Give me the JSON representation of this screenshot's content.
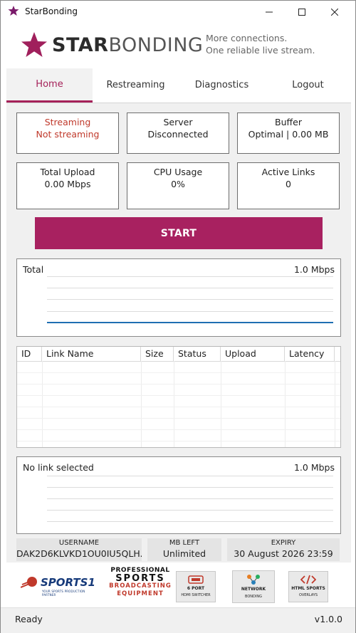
{
  "window": {
    "title": "StarBonding"
  },
  "header": {
    "brand_bold": "STAR",
    "brand_light": "BONDING",
    "tagline_1": "More connections.",
    "tagline_2": "One reliable live stream."
  },
  "tabs": [
    {
      "label": "Home",
      "active": true
    },
    {
      "label": "Restreaming",
      "active": false
    },
    {
      "label": "Diagnostics",
      "active": false
    },
    {
      "label": "Logout",
      "active": false
    }
  ],
  "stats": {
    "streaming": {
      "label": "Streaming",
      "value": "Not streaming"
    },
    "server": {
      "label": "Server",
      "value": "Disconnected"
    },
    "buffer": {
      "label": "Buffer",
      "value": "Optimal | 0.00 MB"
    },
    "upload": {
      "label": "Total Upload",
      "value": "0.00 Mbps"
    },
    "cpu": {
      "label": "CPU Usage",
      "value": "0%"
    },
    "links": {
      "label": "Active Links",
      "value": "0"
    }
  },
  "start_button": {
    "label": "START"
  },
  "total_graph": {
    "label": "Total",
    "max_label": "1.0 Mbps"
  },
  "links_table": {
    "columns": [
      "ID",
      "Link Name",
      "Size",
      "Status",
      "Upload",
      "Latency"
    ],
    "rows": []
  },
  "link_graph": {
    "label": "No link selected",
    "max_label": "1.0 Mbps"
  },
  "account": {
    "username_label": "USERNAME",
    "username": "DAK2D6KLVKD1OU0IU5QLH...",
    "mb_left_label": "MB LEFT",
    "mb_left": "Unlimited",
    "expiry_label": "EXPIRY",
    "expiry": "30 August 2026 23:59"
  },
  "partners": {
    "sports1": "SPORTS1",
    "sports1_sub": "YOUR SPORTS PRODUCTION PARTNER",
    "pro_1": "PROFESSIONAL",
    "pro_2": "SPORTS",
    "pro_3": "BROADCASTING",
    "pro_4": "EQUIPMENT",
    "badge1_title": "6 PORT",
    "badge1_sub": "HDMI SWITCHER",
    "badge2_title": "NETWORK",
    "badge2_sub": "BONDING",
    "badge3_title": "HTML SPORTS",
    "badge3_sub": "OVERLAYS"
  },
  "statusbar": {
    "status": "Ready",
    "version": "v1.0.0"
  },
  "colors": {
    "accent": "#a82160",
    "error_text": "#c0392b",
    "graph_line": "#1f6fb2"
  }
}
